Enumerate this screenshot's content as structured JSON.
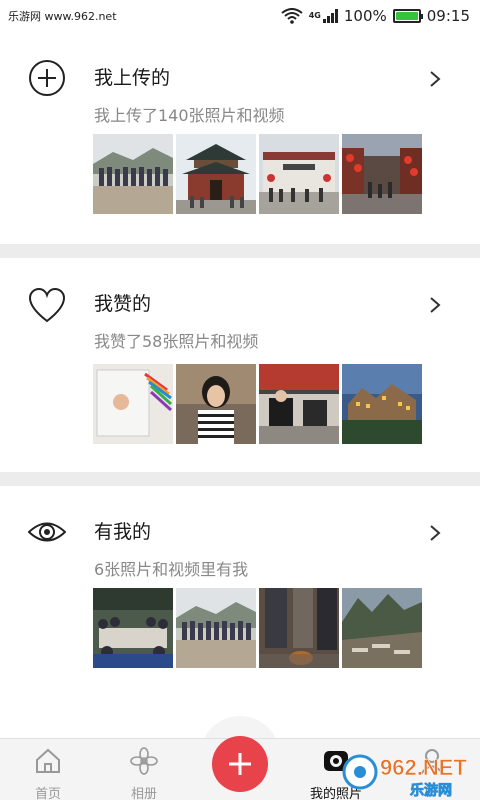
{
  "status_bar": {
    "watermark": "乐游网 www.962.net",
    "network": "4G",
    "battery": "100%",
    "time": "09:15"
  },
  "sections": [
    {
      "id": "uploads",
      "icon": "plus-circle-icon",
      "title": "我上传的",
      "subtitle": "我上传了140张照片和视频"
    },
    {
      "id": "likes",
      "icon": "heart-icon",
      "title": "我赞的",
      "subtitle": "我赞了58张照片和视频"
    },
    {
      "id": "with-me",
      "icon": "eye-icon",
      "title": "有我的",
      "subtitle": "6张照片和视频里有我"
    }
  ],
  "bottom_nav": {
    "items": [
      {
        "label": "首页",
        "icon": "home-icon"
      },
      {
        "label": "相册",
        "icon": "flower-icon"
      },
      {
        "label": "我的照片",
        "icon": "camera-icon",
        "active": true
      },
      {
        "label": "",
        "icon": "person-icon"
      }
    ],
    "fab_icon": "plus-icon"
  },
  "watermark_logo": {
    "line1": "962.NET",
    "line2": "乐游网"
  },
  "colors": {
    "accent": "#e8424b",
    "divider": "#ececec",
    "nav_bg": "#f4f4f4"
  }
}
